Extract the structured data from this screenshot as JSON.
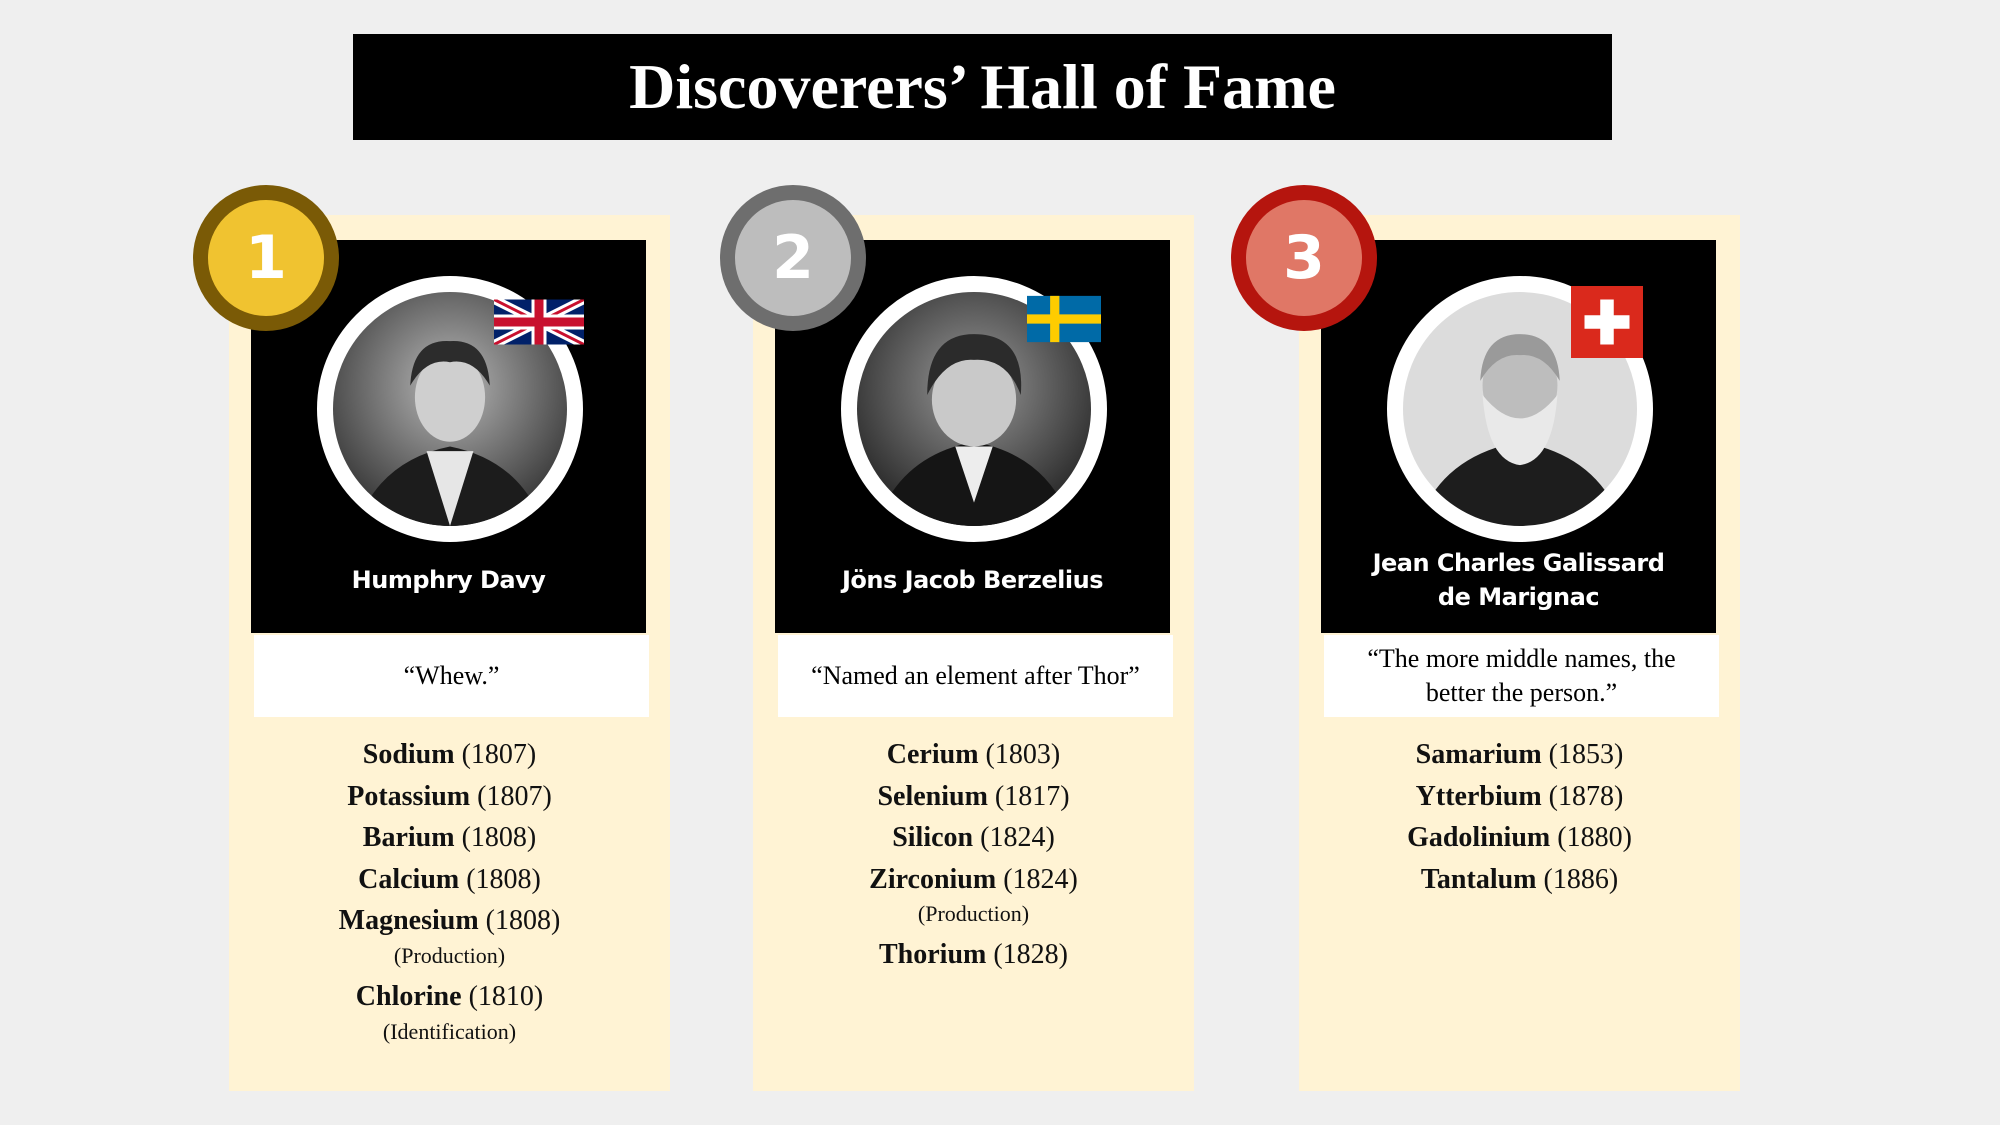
{
  "title": "Discoverers’ Hall of Fame",
  "colors": {
    "background": "#efefef",
    "card": "#fff3d4",
    "gold": "#f0c330",
    "gold_ring": "#7a5a06",
    "silver": "#bdbdbd",
    "silver_ring": "#6e6e6e",
    "bronze": "#e07766",
    "bronze_ring": "#b5150e"
  },
  "cards": [
    {
      "rank": "1",
      "name_lines": [
        "Humphry Davy",
        ""
      ],
      "flag": "united-kingdom-flag",
      "quote_lines": [
        "“Whew.”",
        ""
      ],
      "elements": [
        {
          "name": "Sodium",
          "year": "(1807)",
          "note": ""
        },
        {
          "name": "Potassium",
          "year": "(1807)",
          "note": ""
        },
        {
          "name": "Barium",
          "year": "(1808)",
          "note": ""
        },
        {
          "name": "Calcium",
          "year": "(1808)",
          "note": ""
        },
        {
          "name": "Magnesium",
          "year": "(1808)",
          "note": "(Production)"
        },
        {
          "name": "Chlorine",
          "year": "(1810)",
          "note": "(Identification)"
        }
      ]
    },
    {
      "rank": "2",
      "name_lines": [
        "Jöns Jacob Berzelius",
        ""
      ],
      "flag": "sweden-flag",
      "quote_lines": [
        "“Named an element after Thor”",
        ""
      ],
      "elements": [
        {
          "name": "Cerium",
          "year": "(1803)",
          "note": ""
        },
        {
          "name": "Selenium",
          "year": "(1817)",
          "note": ""
        },
        {
          "name": "Silicon",
          "year": "(1824)",
          "note": ""
        },
        {
          "name": "Zirconium",
          "year": "(1824)",
          "note": "(Production)"
        },
        {
          "name": "Thorium",
          "year": "(1828)",
          "note": ""
        }
      ]
    },
    {
      "rank": "3",
      "name_lines": [
        "Jean Charles Galissard",
        "de Marignac"
      ],
      "flag": "switzerland-flag",
      "quote_lines": [
        "“The more middle names, the",
        "better the person.”"
      ],
      "elements": [
        {
          "name": "Samarium",
          "year": "(1853)",
          "note": ""
        },
        {
          "name": "Ytterbium",
          "year": "(1878)",
          "note": ""
        },
        {
          "name": "Gadolinium",
          "year": "(1880)",
          "note": ""
        },
        {
          "name": "Tantalum",
          "year": "(1886)",
          "note": ""
        }
      ]
    }
  ]
}
